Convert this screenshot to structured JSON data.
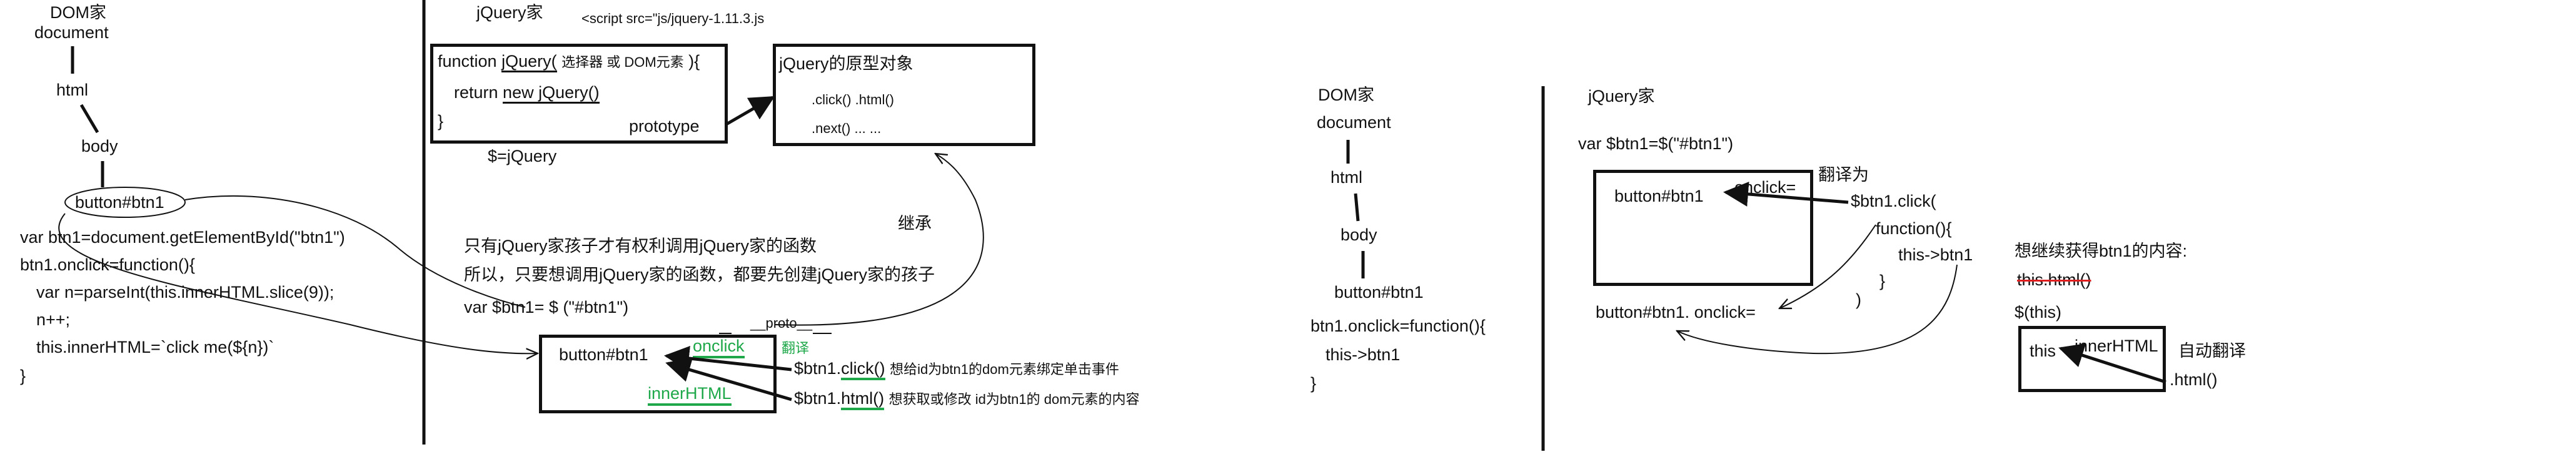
{
  "left": {
    "dom_family": "DOM家",
    "document": "document",
    "html": "html",
    "body": "body",
    "button": "button#btn1",
    "code": [
      "var btn1=document.getElementById(\"btn1\")",
      "btn1.onclick=function(){",
      "  var n=parseInt(this.innerHTML.slice(9));",
      "  n++;",
      "  this.innerHTML=`click me(${n})`",
      "}"
    ]
  },
  "middle": {
    "jq_family": "jQuery家",
    "script_tag": "<script src=\"js/jquery-1.11.3.js",
    "fn_line1_a": "function ",
    "fn_line1_name": "jQuery(",
    "fn_line1_param": "选择器 或 DOM元素",
    "fn_line1_b": " ){",
    "fn_line2_a": "return ",
    "fn_line2_b": "new jQuery()",
    "fn_line3": "}",
    "prototype": "prototype",
    "alias": "$=jQuery",
    "proto_obj_title": "jQuery的原型对象",
    "proto_obj_row1": ".click()    .html()",
    "proto_obj_row2": ".next()    ... ...",
    "inherit": "继承",
    "note1": "只有jQuery家孩子才有权利调用jQuery家的函数",
    "note2": "所以，只要想调用jQuery家的函数，都要先创建jQuery家的孩子",
    "var_line": "var $btn1= $ (\"#btn1\")",
    "proto_label": "__proto__",
    "box_button": "button#btn1",
    "onclick": "onclick",
    "translate": "翻译",
    "innerHTML": "innerHTML",
    "call1_obj": "$btn1.",
    "call1_fn": "click()",
    "call1_desc": "想给id为btn1的dom元素绑定单击事件",
    "call2_obj": "$btn1.",
    "call2_fn": "html()",
    "call2_desc": "想获取或修改 id为btn1的 dom元素的内容"
  },
  "right_dom": {
    "dom_family": "DOM家",
    "document": "document",
    "html": "html",
    "body": "body",
    "button": "button#btn1",
    "code1": "btn1.onclick=function(){",
    "code2": "this->btn1",
    "code3": "}"
  },
  "right_jq": {
    "jq_family": "jQuery家",
    "var_line": "var $btn1=$(\"#btn1\")",
    "box_button": "button#btn1",
    "onclick": "onclick=",
    "translate": "翻译为",
    "click_call": "$btn1.click(",
    "function_open": "function(){",
    "this_line": "this->btn1",
    "close1": "}",
    "close2": ")",
    "bottom_line": "button#btn1. onclick=",
    "want": "想继续获得btn1的内容:",
    "struck": "this.html()",
    "wrap": "$(this)",
    "this_box": "this",
    "innerHTML": "innerHTML",
    "auto_translate": "自动翻译",
    "html_call": ".html()"
  },
  "colors": {
    "ink": "#111111",
    "green": "#1fa84a",
    "red": "#e02020"
  }
}
